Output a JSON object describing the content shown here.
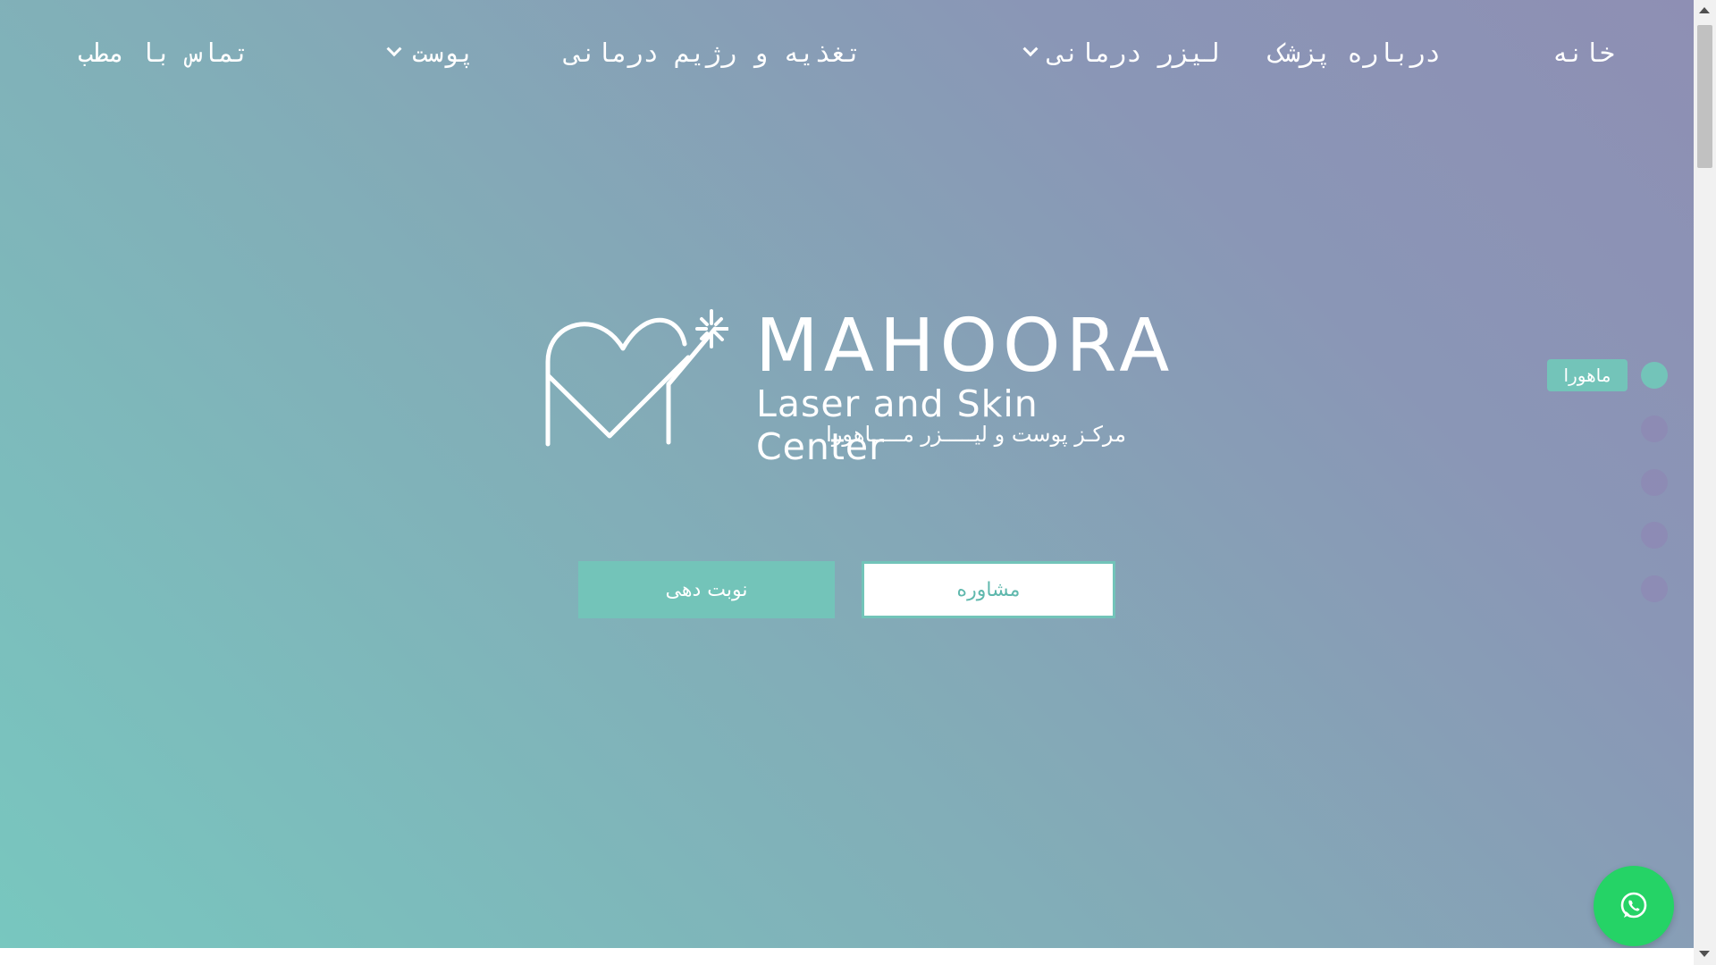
{
  "nav": {
    "items": [
      {
        "label": "خانه",
        "has_dropdown": false
      },
      {
        "label": "درباره پزشک",
        "has_dropdown": false
      },
      {
        "label": "لیزر درمانی",
        "has_dropdown": true
      },
      {
        "label": "تغذیه و رژیم درمانی",
        "has_dropdown": false
      },
      {
        "label": "پوست",
        "has_dropdown": true
      },
      {
        "label": "تماس با مطب",
        "has_dropdown": false
      }
    ]
  },
  "hero": {
    "logo": {
      "name": "MAHOORA",
      "subtitle": "Laser and Skin Center",
      "persian": "مرکـز پوست و لیـــــزر مـــــاهورا"
    },
    "buttons": {
      "consult_label": "مشاوره",
      "booking_label": "نوبت دهی"
    },
    "section_nav": {
      "active_label": "ماهورا",
      "dot_count": 5,
      "active_index": 0
    }
  },
  "colors": {
    "accent": "#73c4b9",
    "gradient_start": "#78c7bf",
    "gradient_end": "#8e8fb4",
    "whatsapp": "#25d366"
  },
  "icons": {
    "whatsapp": "whatsapp-icon",
    "logo": "heart-wand-logo"
  }
}
